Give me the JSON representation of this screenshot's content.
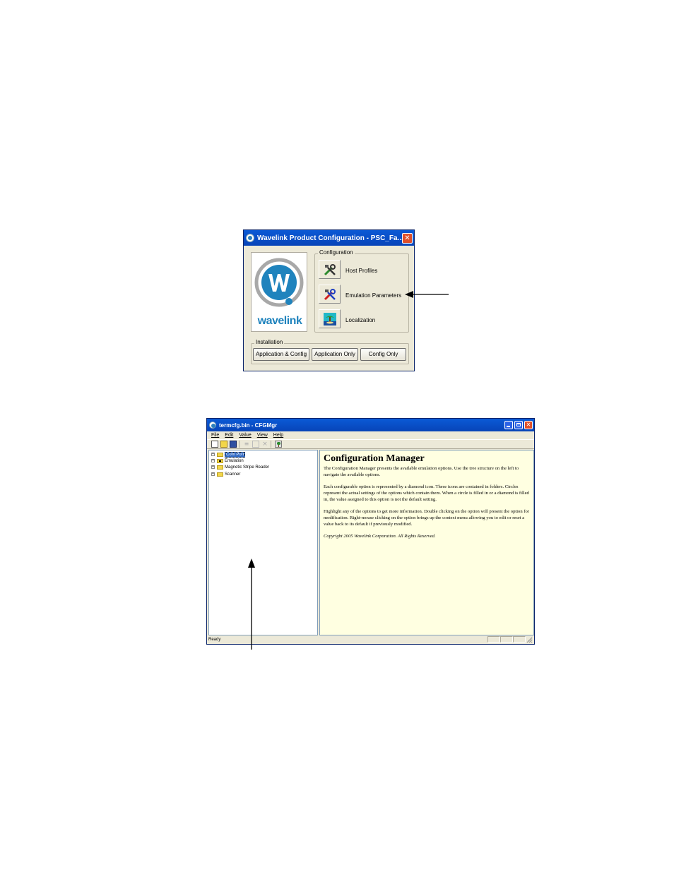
{
  "dialog": {
    "title": "Wavelink Product Configuration - PSC_Fa...",
    "close_glyph": "✕",
    "logo_text": "wavelink",
    "configuration": {
      "label": "Configuration",
      "items": [
        {
          "label": "Host Profiles",
          "icon": "tools-icon"
        },
        {
          "label": "Emulation Parameters",
          "icon": "tools-red-icon"
        },
        {
          "label": "Localization",
          "icon": "globe-palm-icon"
        }
      ]
    },
    "installation": {
      "label": "Installation",
      "buttons": [
        "Application & Config",
        "Application Only",
        "Config Only"
      ]
    }
  },
  "cfgmgr": {
    "title": "termcfg.bin - CFGMgr",
    "close_glyph": "✕",
    "menu": [
      "File",
      "Edit",
      "Value",
      "View",
      "Help"
    ],
    "toolbar_icons": [
      "new-icon",
      "open-icon",
      "save-icon",
      "cut-icon",
      "properties-icon",
      "delete-icon",
      "tree-icon"
    ],
    "tree": [
      {
        "label": "Com Port",
        "selected": true
      },
      {
        "label": "Emulation",
        "selected": false
      },
      {
        "label": "Magnetic Stripe Reader",
        "selected": false
      },
      {
        "label": "Scanner",
        "selected": false
      }
    ],
    "content": {
      "heading": "Configuration Manager",
      "paragraphs": [
        "The Configuration Manager presents the available emulation options.  Use the tree structure on the left to navigate the available options.",
        "Each configurable option is represented by a diamond icon.  These icons are contained in folders.  Circles represent the actual settings of the options which contain them.  When a circle is filled in or a diamond is filled in, the value assigned to this option is not the default setting.",
        "Highlight any of the options to get more information.  Double clicking on the option will present the option for modification. Right-mouse clicking on the option brings up the context menu allowing you to edit or reset a value back to its default if previously modified."
      ],
      "copyright": "Copyright 2005 Wavelink Corporation. All Rights Reserved."
    },
    "status": "Ready"
  },
  "colors": {
    "titlebar": "#0a5ad6",
    "dialog_bg": "#ece9d8",
    "help_bg": "#ffffe1",
    "logo_blue": "#1f83bd",
    "selection": "#316ac5"
  }
}
